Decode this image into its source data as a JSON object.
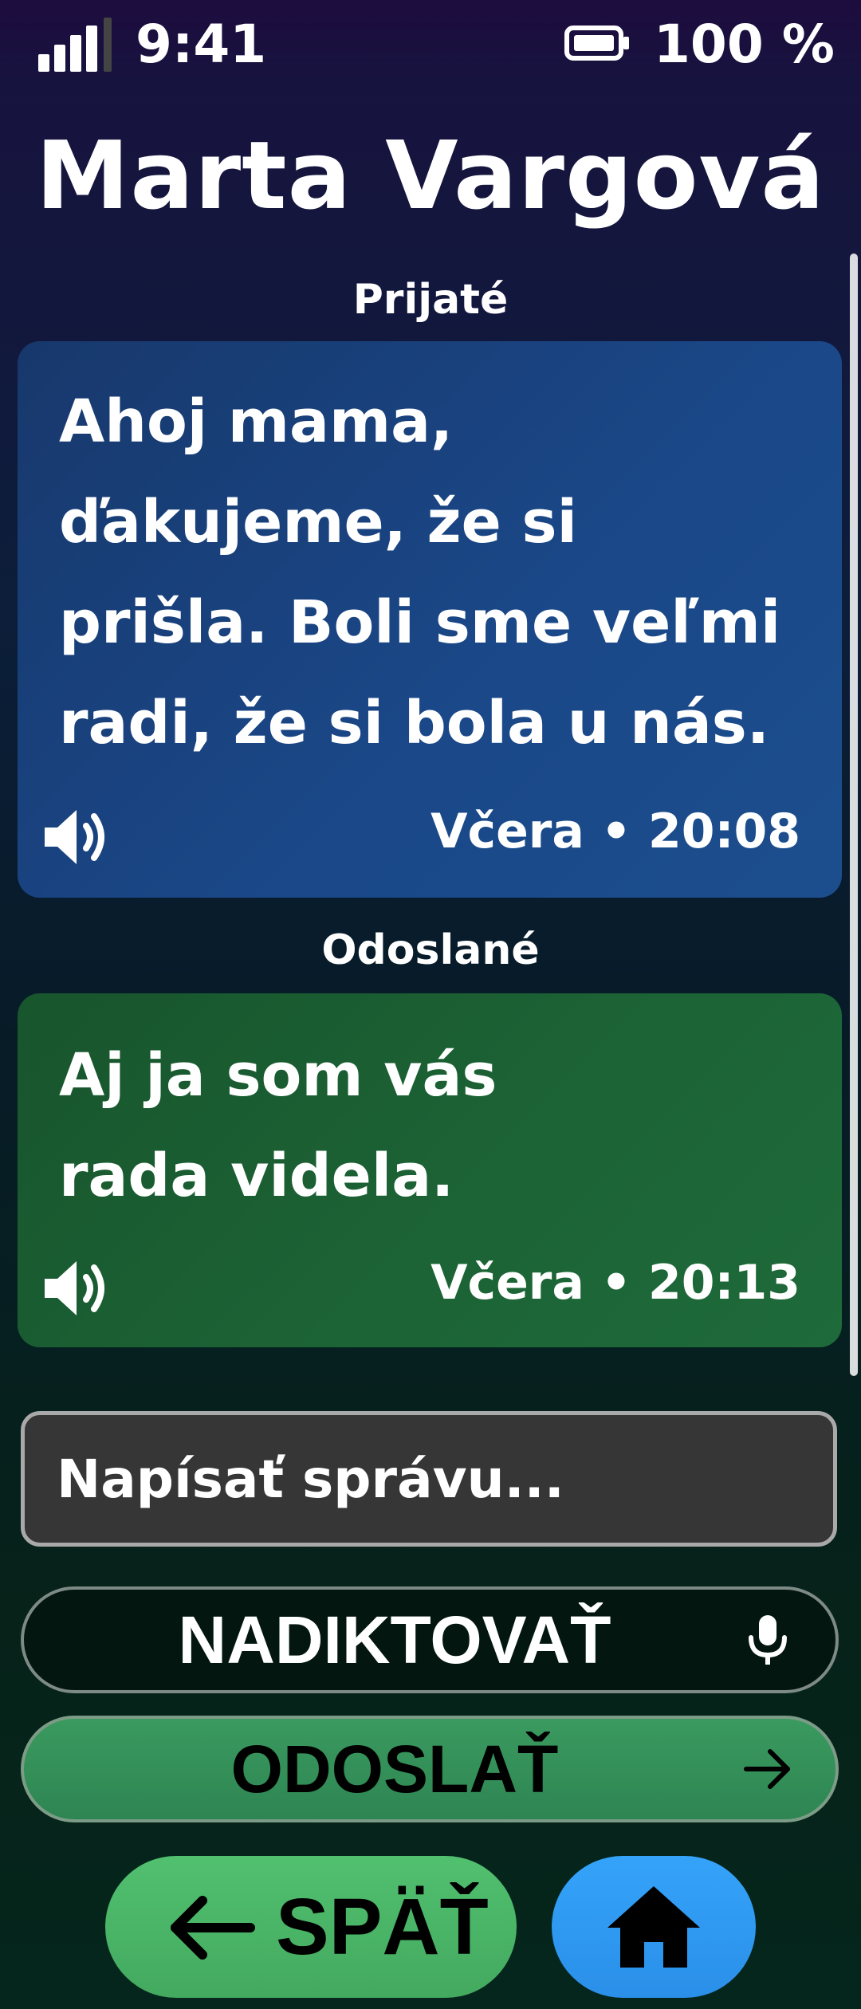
{
  "status_bar": {
    "time": "9:41",
    "battery_percent": "100 %",
    "battery_level": 1.0,
    "signal_bars": 4
  },
  "contact": {
    "name": "Marta Vargová"
  },
  "conversation": {
    "received_label": "Prijaté",
    "sent_label": "Odoslané",
    "messages": [
      {
        "direction": "received",
        "lines": [
          "Ahoj mama,",
          "ďakujeme, že si",
          "prišla. Boli sme veľmi",
          "radi, že si bola u nás."
        ],
        "timestamp": "Včera • 20:08"
      },
      {
        "direction": "sent",
        "lines": [
          "Aj ja som vás",
          "rada videla."
        ],
        "timestamp": "Včera • 20:13"
      }
    ]
  },
  "composer": {
    "placeholder": "Napísať správu...",
    "value": ""
  },
  "actions": {
    "dictate_label": "NADIKTOVAŤ",
    "send_label": "ODOSLAŤ",
    "back_label": "SPÄŤ"
  },
  "icons": {
    "signal": "signal-bars-icon",
    "battery": "battery-icon",
    "speaker": "speaker-icon",
    "mic": "microphone-icon",
    "send_arrow": "arrow-right-icon",
    "back_arrow": "arrow-left-icon",
    "home": "home-icon"
  },
  "colors": {
    "received_bubble": "#1a4787",
    "sent_bubble": "#1c6335",
    "send_button": "#3a9a5f",
    "back_button": "#4bb567",
    "home_button": "#2e98f0",
    "input_background": "#363636"
  }
}
